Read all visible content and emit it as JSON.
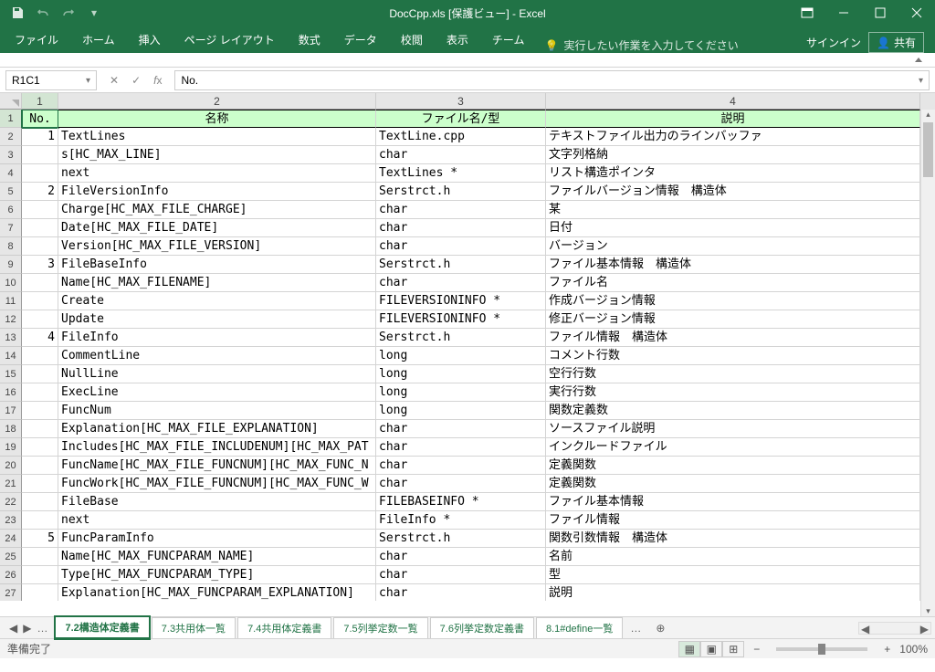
{
  "title": "DocCpp.xls  [保護ビュー] - Excel",
  "ribbon": {
    "tabs": [
      "ファイル",
      "ホーム",
      "挿入",
      "ページ レイアウト",
      "数式",
      "データ",
      "校閲",
      "表示",
      "チーム"
    ],
    "tellme": "実行したい作業を入力してください",
    "signin": "サインイン",
    "share": "共有"
  },
  "formula": {
    "namebox": "R1C1",
    "fx": "No."
  },
  "columns": [
    "1",
    "2",
    "3",
    "4"
  ],
  "headers": {
    "no": "No.",
    "col2": "名称",
    "col3": "ファイル名/型",
    "col4": "説明"
  },
  "rows": [
    {
      "rn": 2,
      "no": "1",
      "b": "TextLines",
      "c": "TextLine.cpp",
      "d": "テキストファイル出力のラインバッファ"
    },
    {
      "rn": 3,
      "no": "",
      "b": "s[HC_MAX_LINE]",
      "c": "char",
      "d": "文字列格納"
    },
    {
      "rn": 4,
      "no": "",
      "b": "next",
      "c": "TextLines *",
      "d": "リスト構造ポインタ"
    },
    {
      "rn": 5,
      "no": "2",
      "b": "FileVersionInfo",
      "c": "Serstrct.h",
      "d": "ファイルバージョン情報　構造体"
    },
    {
      "rn": 6,
      "no": "",
      "b": "Charge[HC_MAX_FILE_CHARGE]",
      "c": "char",
      "d": "某"
    },
    {
      "rn": 7,
      "no": "",
      "b": "Date[HC_MAX_FILE_DATE]",
      "c": "char",
      "d": "日付"
    },
    {
      "rn": 8,
      "no": "",
      "b": "Version[HC_MAX_FILE_VERSION]",
      "c": "char",
      "d": "バージョン"
    },
    {
      "rn": 9,
      "no": "3",
      "b": "FileBaseInfo",
      "c": "Serstrct.h",
      "d": "ファイル基本情報　構造体"
    },
    {
      "rn": 10,
      "no": "",
      "b": "Name[HC_MAX_FILENAME]",
      "c": "char",
      "d": "ファイル名"
    },
    {
      "rn": 11,
      "no": "",
      "b": "Create",
      "c": "FILEVERSIONINFO *",
      "d": "作成バージョン情報"
    },
    {
      "rn": 12,
      "no": "",
      "b": "Update",
      "c": "FILEVERSIONINFO *",
      "d": "修正バージョン情報"
    },
    {
      "rn": 13,
      "no": "4",
      "b": "FileInfo",
      "c": "Serstrct.h",
      "d": "ファイル情報　構造体"
    },
    {
      "rn": 14,
      "no": "",
      "b": "CommentLine",
      "c": "long",
      "d": "コメント行数"
    },
    {
      "rn": 15,
      "no": "",
      "b": "NullLine",
      "c": "long",
      "d": "空行行数"
    },
    {
      "rn": 16,
      "no": "",
      "b": "ExecLine",
      "c": "long",
      "d": "実行行数"
    },
    {
      "rn": 17,
      "no": "",
      "b": "FuncNum",
      "c": "long",
      "d": "関数定義数"
    },
    {
      "rn": 18,
      "no": "",
      "b": "Explanation[HC_MAX_FILE_EXPLANATION]",
      "c": "char",
      "d": "ソースファイル説明"
    },
    {
      "rn": 19,
      "no": "",
      "b": "Includes[HC_MAX_FILE_INCLUDENUM][HC_MAX_PAT",
      "c": "char",
      "d": "インクルードファイル"
    },
    {
      "rn": 20,
      "no": "",
      "b": "FuncName[HC_MAX_FILE_FUNCNUM][HC_MAX_FUNC_N",
      "c": "char",
      "d": "定義関数"
    },
    {
      "rn": 21,
      "no": "",
      "b": "FuncWork[HC_MAX_FILE_FUNCNUM][HC_MAX_FUNC_W",
      "c": "char",
      "d": "定義関数"
    },
    {
      "rn": 22,
      "no": "",
      "b": "FileBase",
      "c": "FILEBASEINFO *",
      "d": "ファイル基本情報"
    },
    {
      "rn": 23,
      "no": "",
      "b": "next",
      "c": "FileInfo *",
      "d": "ファイル情報"
    },
    {
      "rn": 24,
      "no": "5",
      "b": "FuncParamInfo",
      "c": "Serstrct.h",
      "d": "関数引数情報　構造体"
    },
    {
      "rn": 25,
      "no": "",
      "b": "Name[HC_MAX_FUNCPARAM_NAME]",
      "c": "char",
      "d": "名前"
    },
    {
      "rn": 26,
      "no": "",
      "b": "Type[HC_MAX_FUNCPARAM_TYPE]",
      "c": "char",
      "d": "型"
    },
    {
      "rn": 27,
      "no": "",
      "b": "Explanation[HC_MAX_FUNCPARAM_EXPLANATION]",
      "c": "char",
      "d": "説明"
    }
  ],
  "sheets": [
    "7.2構造体定義書",
    "7.3共用体一覧",
    "7.4共用体定義書",
    "7.5列挙定数一覧",
    "7.6列挙定数定義書",
    "8.1#define一覧"
  ],
  "status": {
    "ready": "準備完了",
    "zoom": "100%"
  }
}
